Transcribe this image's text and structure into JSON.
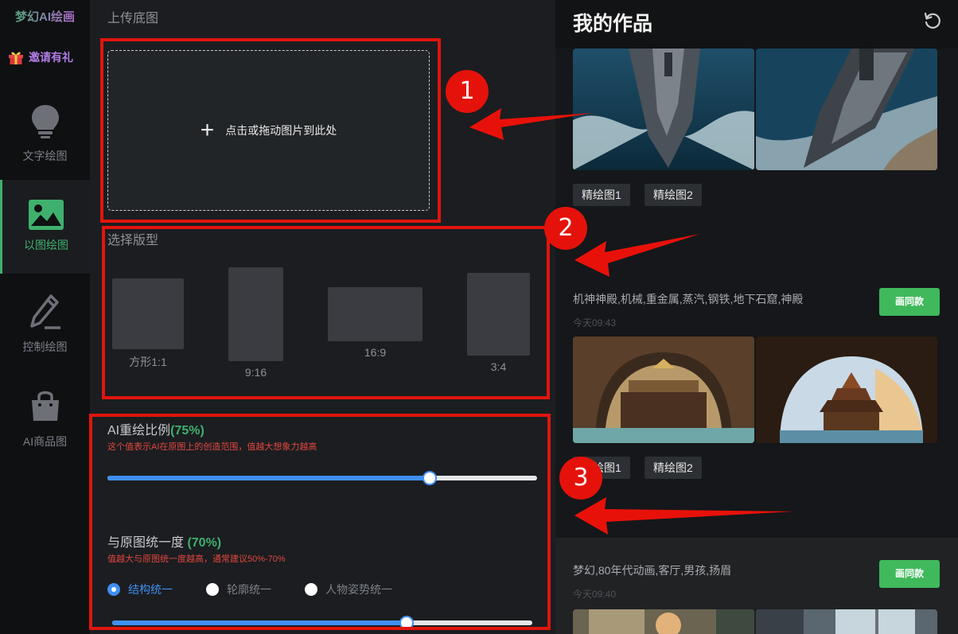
{
  "sidebar": {
    "logo": "梦幻AI绘画",
    "invite": "邀请有礼",
    "items": [
      {
        "label": "文字绘图",
        "icon": "lightbulb-icon"
      },
      {
        "label": "以图绘图",
        "icon": "image-icon"
      },
      {
        "label": "控制绘图",
        "icon": "pencil-icon"
      },
      {
        "label": "AI商品图",
        "icon": "shopping-bag-icon"
      }
    ],
    "active_item": "以图绘图"
  },
  "upload": {
    "title": "上传底图",
    "plus": "+",
    "text": "点击或拖动图片到此处"
  },
  "format": {
    "title": "选择版型",
    "options": [
      {
        "label": "方形1:1"
      },
      {
        "label": "9:16"
      },
      {
        "label": "16:9"
      },
      {
        "label": "3:4"
      }
    ]
  },
  "redraw": {
    "title": "AI重绘比例",
    "percent": "(75%)",
    "hint": "这个值表示AI在原图上的创造范围，值越大想象力越高",
    "value": 0.75
  },
  "unify": {
    "title": "与原图统一度 ",
    "percent": "(70%)",
    "hint": "值越大与原图统一度越高，通常建议50%-70%",
    "value": 0.7,
    "modes": [
      "结构统一",
      "轮廓统一",
      "人物姿势统一"
    ],
    "selected_mode": "结构统一"
  },
  "works": {
    "title": "我的作品",
    "refresh_icon": "refresh-icon",
    "cards": [
      {
        "prompt": "",
        "time": "",
        "tags": [
          "精绘图1",
          "精绘图2"
        ],
        "images": [
          "aircraft-carrier-image-1",
          "aircraft-carrier-image-2"
        ]
      },
      {
        "prompt": "机神神殿,机械,重金属,蒸汽,钢铁,地下石窟,神殿",
        "time": "今天09:43",
        "button": "画同款",
        "tags": [
          "精绘图1",
          "精绘图2"
        ],
        "images": [
          "temple-image-1",
          "temple-image-2"
        ]
      },
      {
        "prompt": "梦幻,80年代动画,客厅,男孩,扬眉",
        "time": "今天09:40",
        "button": "画同款",
        "images": [
          "anime-room-image-1",
          "anime-room-image-2"
        ]
      }
    ]
  },
  "annotations": {
    "badges": [
      "1",
      "2",
      "3"
    ],
    "color": "#e0150e"
  },
  "colors": {
    "accent_green": "#3fb06d",
    "slider_blue": "#3f8ff3",
    "hint_red": "#e2473f",
    "button_green": "#3fb95c"
  }
}
